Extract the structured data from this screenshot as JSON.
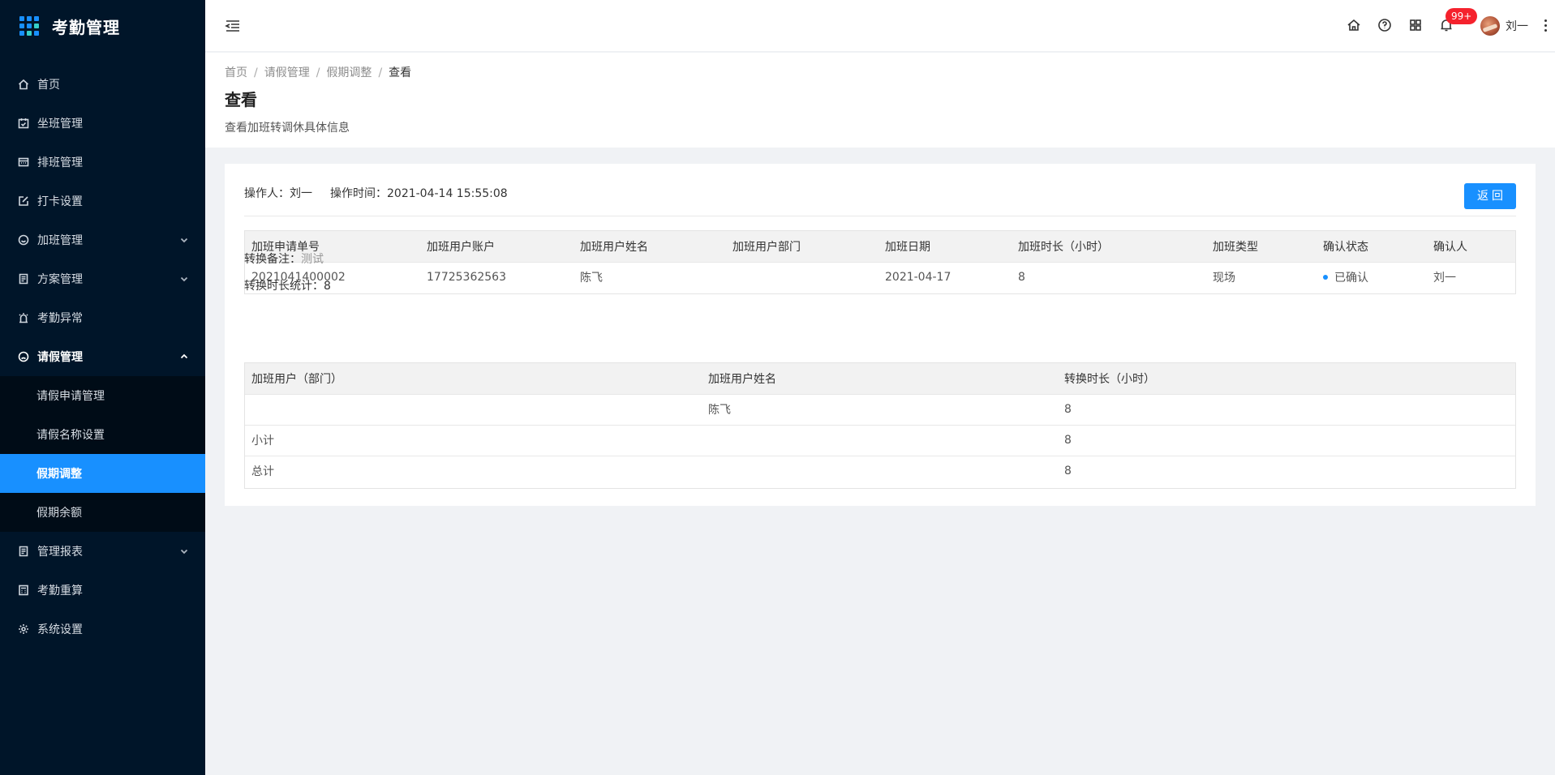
{
  "app": {
    "title": "考勤管理"
  },
  "sidebar": {
    "items": [
      {
        "label": "首页"
      },
      {
        "label": "坐班管理"
      },
      {
        "label": "排班管理"
      },
      {
        "label": "打卡设置"
      },
      {
        "label": "加班管理"
      },
      {
        "label": "方案管理"
      },
      {
        "label": "考勤异常"
      },
      {
        "label": "请假管理"
      },
      {
        "label": "管理报表"
      },
      {
        "label": "考勤重算"
      },
      {
        "label": "系统设置"
      }
    ],
    "leave_submenu": [
      {
        "label": "请假申请管理"
      },
      {
        "label": "请假名称设置"
      },
      {
        "label": "假期调整"
      },
      {
        "label": "假期余额"
      }
    ]
  },
  "header": {
    "badge": "99+",
    "username": "刘一"
  },
  "breadcrumb": [
    "首页",
    "请假管理",
    "假期调整",
    "查看"
  ],
  "page": {
    "title": "查看",
    "description": "查看加班转调休具体信息"
  },
  "meta": {
    "operator_label": "操作人：",
    "operator": "刘一",
    "time_label": "操作时间：",
    "time": "2021-04-14 15:55:08",
    "back_button": "返回"
  },
  "overtime_table": {
    "headers": [
      "加班申请单号",
      "加班用户账户",
      "加班用户姓名",
      "加班用户部门",
      "加班日期",
      "加班时长（小时）",
      "加班类型",
      "确认状态",
      "确认人"
    ],
    "rows": [
      [
        "2021041400002",
        "17725362563",
        "陈飞",
        "",
        "2021-04-17",
        "8",
        "现场",
        "已确认",
        "刘一"
      ]
    ]
  },
  "remark": {
    "label": "转换备注：",
    "value": "测试"
  },
  "stats": {
    "label": "转换时长统计：",
    "value": "8"
  },
  "summary_table": {
    "headers": [
      "加班用户（部门）",
      "加班用户姓名",
      "转换时长（小时）"
    ],
    "rows": [
      [
        "",
        "陈飞",
        "8"
      ],
      [
        "小计",
        "",
        "8"
      ],
      [
        "总计",
        "",
        "8"
      ]
    ]
  },
  "colors": {
    "primary": "#1890ff",
    "sidebar_bg": "#001529",
    "badge": "#f5222d"
  }
}
